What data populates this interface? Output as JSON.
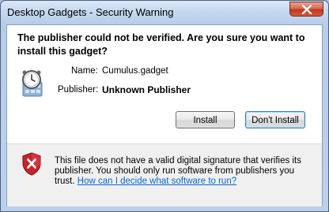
{
  "window": {
    "title": "Desktop Gadgets - Security Warning"
  },
  "dialog": {
    "heading": "The publisher could not be verified. Are you sure you want to install this gadget?",
    "name_label": "Name:",
    "name_value": "Cumulus.gadget",
    "publisher_label": "Publisher:",
    "publisher_value": "Unknown Publisher",
    "install_label": "Install",
    "dont_install_label": "Don't Install"
  },
  "warning": {
    "text": "This file does not have a valid digital signature that verifies its publisher. You should only run software from publishers you trust.",
    "link": "How can I decide what software to run?"
  },
  "icons": {
    "close": "close-icon",
    "gadget": "gadget-clock-icon",
    "shield": "security-shield-error-icon"
  },
  "colors": {
    "link": "#0b66d1",
    "close_button": "#c2371b"
  }
}
